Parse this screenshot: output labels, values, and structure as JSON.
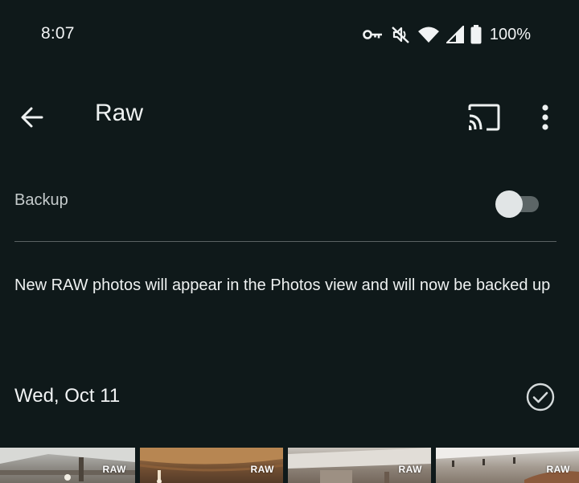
{
  "status_bar": {
    "time": "8:07",
    "battery": "100%",
    "icons": [
      "vpn-key-icon",
      "muted-icon",
      "wifi-icon",
      "cell-signal-icon",
      "battery-icon"
    ]
  },
  "app_bar": {
    "title": "Raw",
    "icons": [
      "back-arrow-icon",
      "cast-icon",
      "more-vert-icon"
    ]
  },
  "backup": {
    "label": "Backup",
    "enabled": false
  },
  "info": {
    "text": "New RAW photos will appear in the Photos view and will now be backed up"
  },
  "section": {
    "date": "Wed, Oct 11",
    "select_icon": "check-circle-icon"
  },
  "photos": [
    {
      "badge": "RAW"
    },
    {
      "badge": "RAW"
    },
    {
      "badge": "RAW"
    },
    {
      "badge": "RAW"
    }
  ],
  "colors": {
    "background": "#0f191a",
    "text": "#eef1f1",
    "divider": "#5a6263"
  }
}
